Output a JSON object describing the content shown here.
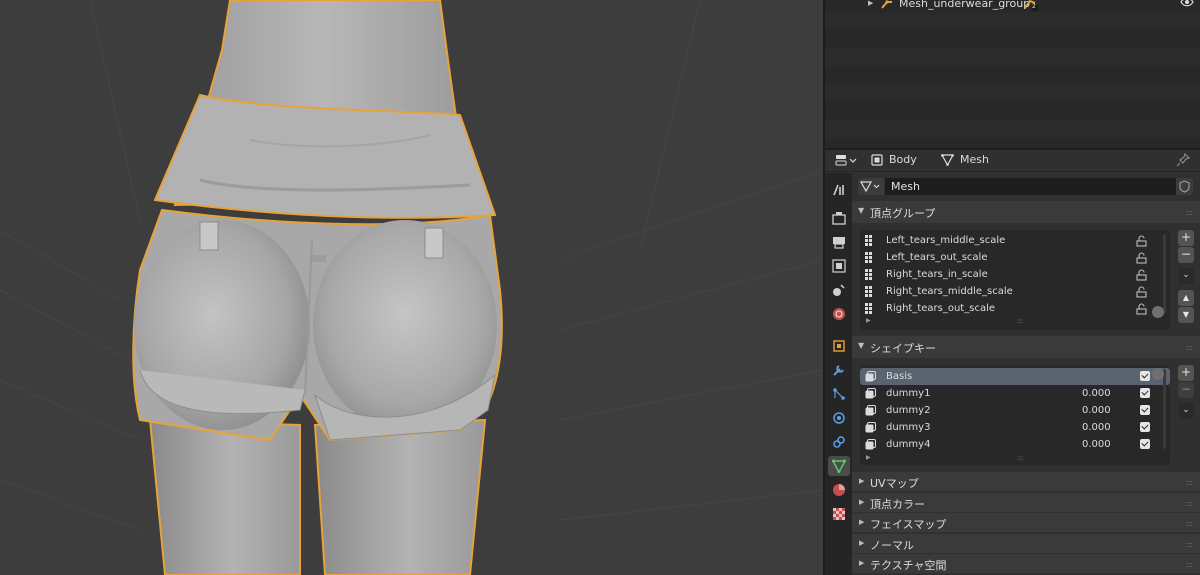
{
  "outliner": {
    "item": {
      "label": "Mesh_underwear_group",
      "users_badge": "2"
    }
  },
  "properties": {
    "breadcrumb": {
      "object": "Body",
      "data": "Mesh"
    },
    "datablock": {
      "name": "Mesh"
    },
    "vertex_groups": {
      "title": "頂点グループ",
      "items": [
        {
          "label": "Left_tears_middle_scale"
        },
        {
          "label": "Left_tears_out_scale"
        },
        {
          "label": "Right_tears_in_scale"
        },
        {
          "label": "Right_tears_middle_scale"
        },
        {
          "label": "Right_tears_out_scale"
        }
      ]
    },
    "shape_keys": {
      "title": "シェイプキー",
      "items": [
        {
          "label": "Basis",
          "value": "",
          "selected": true
        },
        {
          "label": "dummy1",
          "value": "0.000"
        },
        {
          "label": "dummy2",
          "value": "0.000"
        },
        {
          "label": "dummy3",
          "value": "0.000"
        },
        {
          "label": "dummy4",
          "value": "0.000"
        }
      ]
    },
    "collapsed_panels": [
      {
        "title": "UVマップ"
      },
      {
        "title": "頂点カラー"
      },
      {
        "title": "フェイスマップ"
      },
      {
        "title": "ノーマル"
      },
      {
        "title": "テクスチャ空間"
      }
    ],
    "tabs": [
      "tool-icon",
      "render-icon",
      "output-icon",
      "view-layer-icon",
      "scene-icon",
      "world-icon",
      "object-icon",
      "modifier-icon",
      "particles-icon",
      "physics-icon",
      "constraints-icon",
      "mesh-data-icon",
      "material-icon",
      "texture-icon"
    ],
    "active_tab": "mesh-data-icon"
  },
  "colors": {
    "selection_outline": "#e8a23a",
    "active_tab_icon": "#59c86e",
    "viewport_bg": "#3d3d3d"
  }
}
